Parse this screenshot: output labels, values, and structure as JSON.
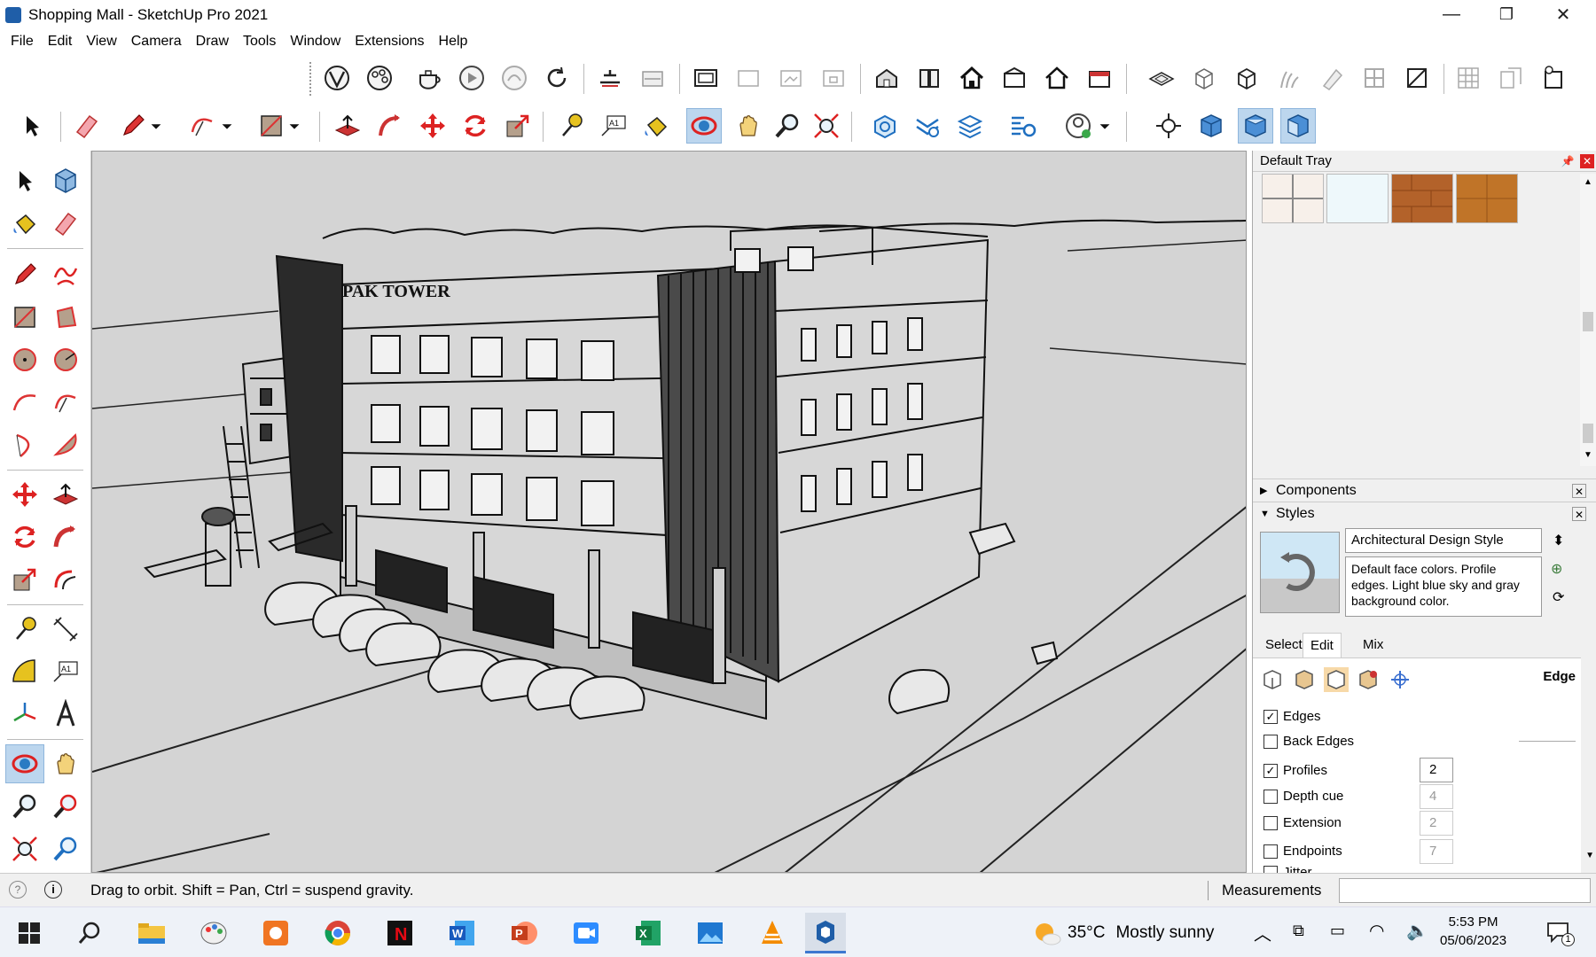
{
  "window": {
    "title": "Shopping Mall - SketchUp Pro 2021",
    "controls": {
      "minimize": "—",
      "restore": "❐",
      "close": "✕"
    }
  },
  "menu": [
    "File",
    "Edit",
    "View",
    "Camera",
    "Draw",
    "Tools",
    "Window",
    "Extensions",
    "Help"
  ],
  "viewport": {
    "sign_text": "PAK TOWER",
    "background_color": "#d4d4d4",
    "line_color": "#111111"
  },
  "tray": {
    "title": "Default Tray",
    "pin_icon": "pin-icon",
    "close_icon": "close-icon",
    "swatches": [
      "#f7f0ea",
      "#eef8fb",
      "#b3622a",
      "#c07428"
    ],
    "panels": {
      "components": {
        "label": "Components",
        "collapsed": true
      },
      "styles": {
        "label": "Styles",
        "collapsed": false
      }
    },
    "style": {
      "name": "Architectural Design Style",
      "description": "Default face colors. Profile edges. Light blue sky and gray background color."
    },
    "tabs": [
      "Select",
      "Edit",
      "Mix"
    ],
    "active_tab": "Edit",
    "edit_section_label": "Edge",
    "edge_options": [
      {
        "label": "Edges",
        "checked": true
      },
      {
        "label": "Back Edges",
        "checked": false
      },
      {
        "label": "Profiles",
        "checked": true,
        "value": "2",
        "enabled": true
      },
      {
        "label": "Depth cue",
        "checked": false,
        "value": "4",
        "enabled": false
      },
      {
        "label": "Extension",
        "checked": false,
        "value": "2",
        "enabled": false
      },
      {
        "label": "Endpoints",
        "checked": false,
        "value": "7",
        "enabled": false
      },
      {
        "label": "Jitter",
        "checked": false
      }
    ]
  },
  "status": {
    "hint": "Drag to orbit. Shift = Pan, Ctrl = suspend gravity.",
    "measurements_label": "Measurements",
    "measurements_value": ""
  },
  "taskbar": {
    "weather_temp": "35°C",
    "weather_text": "Mostly sunny",
    "time": "5:53 PM",
    "date": "05/06/2023",
    "notification_count": "1",
    "apps": [
      "start-icon",
      "search-icon",
      "file-explorer-icon",
      "paint-icon",
      "photos-icon",
      "chrome-icon",
      "netflix-icon",
      "word-icon",
      "powerpoint-icon",
      "zoom-icon",
      "excel-icon",
      "photos-app-icon",
      "vlc-icon",
      "sketchup-icon"
    ],
    "active_app": "sketchup-icon"
  },
  "colors": {
    "accent": "#3b78d0",
    "toolbar_active": "#bcd6ee",
    "sketchup_blue": "#1f5ea8"
  }
}
